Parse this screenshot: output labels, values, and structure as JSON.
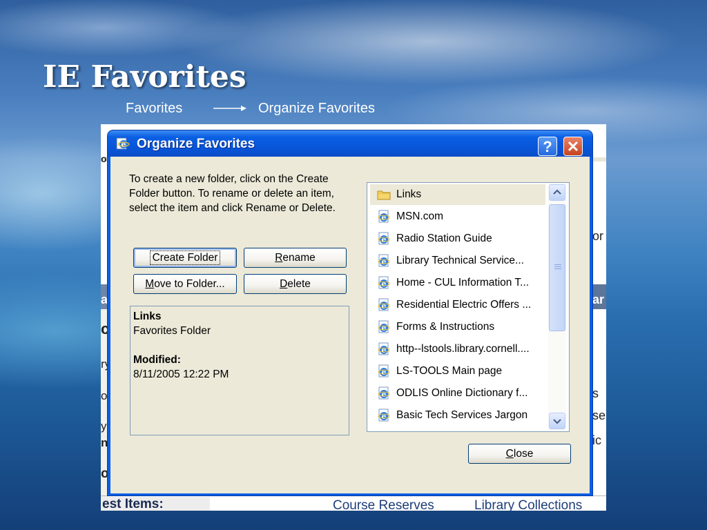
{
  "slide": {
    "title": "IE Favorites",
    "path_from": "Favorites",
    "path_to": "Organize Favorites"
  },
  "background_window": {
    "fragments": [
      "ot",
      "or",
      "ar",
      "ar",
      "cl",
      "ry",
      "of",
      "s",
      "y",
      "se",
      "n",
      "ic",
      "oi"
    ],
    "bottom_left": "est Items:",
    "bottom_links": [
      "Course Reserves",
      "Library Collections"
    ]
  },
  "dialog": {
    "title": "Organize Favorites",
    "help_label": "?",
    "close_label": "✕",
    "instructions": "To create a new folder, click on the Create Folder button. To rename or delete an item, select the item and click Rename or Delete.",
    "buttons": {
      "create_folder": "Create Folder",
      "rename_first": "R",
      "rename_rest": "ename",
      "move_first": "M",
      "move_rest": "ove to Folder...",
      "delete_first": "D",
      "delete_rest": "elete",
      "close_first": "C",
      "close_rest": "lose"
    },
    "info": {
      "name": "Links",
      "type": "Favorites Folder",
      "modified_label": "Modified:",
      "modified_value": "8/11/2005 12:22 PM"
    },
    "favorites": [
      {
        "label": "Links",
        "icon": "folder-icon"
      },
      {
        "label": "MSN.com",
        "icon": "ie-page-icon"
      },
      {
        "label": "Radio Station Guide",
        "icon": "ie-page-icon"
      },
      {
        "label": "Library Technical Service...",
        "icon": "ie-page-icon"
      },
      {
        "label": "Home - CUL Information T...",
        "icon": "ie-page-icon"
      },
      {
        "label": "Residential Electric Offers ...",
        "icon": "ie-page-icon"
      },
      {
        "label": "Forms & Instructions",
        "icon": "ie-page-icon"
      },
      {
        "label": "http--lstools.library.cornell....",
        "icon": "ie-page-icon"
      },
      {
        "label": "LS-TOOLS Main page",
        "icon": "ie-page-icon"
      },
      {
        "label": "ODLIS Online Dictionary f...",
        "icon": "ie-page-icon"
      },
      {
        "label": "Basic Tech Services Jargon",
        "icon": "ie-page-icon"
      }
    ],
    "colors": {
      "title_bar": "#0a5fe3",
      "dialog_face": "#ece9d8",
      "close_button": "#c6451f",
      "list_border": "#7f9db9"
    }
  }
}
